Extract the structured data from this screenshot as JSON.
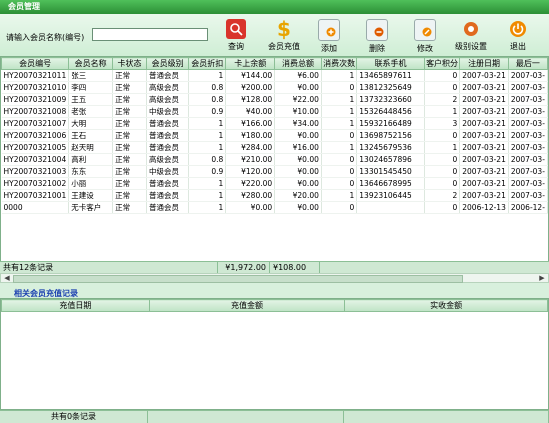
{
  "window": {
    "title": "会员管理"
  },
  "search": {
    "label": "请输入会员名称(编号)",
    "value": ""
  },
  "toolbar": [
    {
      "name": "query-button",
      "label": "查询",
      "icon": "search-icon",
      "color": "#d9342b"
    },
    {
      "name": "recharge-button",
      "label": "会员充值",
      "icon": "dollar-icon",
      "color": "#e8a400"
    },
    {
      "name": "add-button",
      "label": "添加",
      "icon": "add-icon",
      "color": "#e8f0f0"
    },
    {
      "name": "delete-button",
      "label": "删除",
      "icon": "delete-icon",
      "color": "#e8f0f0"
    },
    {
      "name": "edit-button",
      "label": "修改",
      "icon": "edit-icon",
      "color": "#e8f0f0"
    },
    {
      "name": "level-settings-button",
      "label": "级别设置",
      "icon": "settings-icon",
      "color": "#e06a1e"
    },
    {
      "name": "exit-button",
      "label": "退出",
      "icon": "power-icon",
      "color": "#f08a00"
    }
  ],
  "table": {
    "columns": [
      "会员编号",
      "会员名称",
      "卡状态",
      "会员级别",
      "会员折扣",
      "卡上余额",
      "消费总额",
      "消费次数",
      "联系手机",
      "客户积分",
      "注册日期",
      "最后一"
    ],
    "rows": [
      [
        "HY20070321011",
        "张三",
        "正常",
        "普通会员",
        "1",
        "¥144.00",
        "¥6.00",
        "1",
        "13465897611",
        "0",
        "2007-03-21",
        "2007-03-"
      ],
      [
        "HY20070321010",
        "李四",
        "正常",
        "高级会员",
        "0.8",
        "¥200.00",
        "¥0.00",
        "0",
        "13812325649",
        "0",
        "2007-03-21",
        "2007-03-"
      ],
      [
        "HY20070321009",
        "王五",
        "正常",
        "高级会员",
        "0.8",
        "¥128.00",
        "¥22.00",
        "1",
        "13732323660",
        "2",
        "2007-03-21",
        "2007-03-"
      ],
      [
        "HY20070321008",
        "老张",
        "正常",
        "中级会员",
        "0.9",
        "¥40.00",
        "¥10.00",
        "1",
        "15326448456",
        "1",
        "2007-03-21",
        "2007-03-"
      ],
      [
        "HY20070321007",
        "大明",
        "正常",
        "普通会员",
        "1",
        "¥166.00",
        "¥34.00",
        "1",
        "15932166489",
        "3",
        "2007-03-21",
        "2007-03-"
      ],
      [
        "HY20070321006",
        "王石",
        "正常",
        "普通会员",
        "1",
        "¥180.00",
        "¥0.00",
        "0",
        "13698752156",
        "0",
        "2007-03-21",
        "2007-03-"
      ],
      [
        "HY20070321005",
        "赵天明",
        "正常",
        "普通会员",
        "1",
        "¥284.00",
        "¥16.00",
        "1",
        "13245679536",
        "1",
        "2007-03-21",
        "2007-03-"
      ],
      [
        "HY20070321004",
        "高利",
        "正常",
        "高级会员",
        "0.8",
        "¥210.00",
        "¥0.00",
        "0",
        "13024657896",
        "0",
        "2007-03-21",
        "2007-03-"
      ],
      [
        "HY20070321003",
        "东东",
        "正常",
        "中级会员",
        "0.9",
        "¥120.00",
        "¥0.00",
        "0",
        "13301545450",
        "0",
        "2007-03-21",
        "2007-03-"
      ],
      [
        "HY20070321002",
        "小丽",
        "正常",
        "普通会员",
        "1",
        "¥220.00",
        "¥0.00",
        "0",
        "13646678995",
        "0",
        "2007-03-21",
        "2007-03-"
      ],
      [
        "HY20070321001",
        "王建设",
        "正常",
        "普通会员",
        "1",
        "¥280.00",
        "¥20.00",
        "1",
        "13923106445",
        "2",
        "2007-03-21",
        "2007-03-"
      ],
      [
        "0000",
        "无卡客户",
        "正常",
        "普通会员",
        "1",
        "¥0.00",
        "¥0.00",
        "0",
        "",
        "0",
        "2006-12-13",
        "2006-12-"
      ]
    ]
  },
  "summary": {
    "count": "共有12条记录",
    "balance_total": "¥1,972.00",
    "consume_total": "¥108.00"
  },
  "recharge": {
    "title": "相关会员充值记录",
    "columns": [
      "充值日期",
      "充值金额",
      "实收金额"
    ],
    "footer": "共有0条记录"
  }
}
